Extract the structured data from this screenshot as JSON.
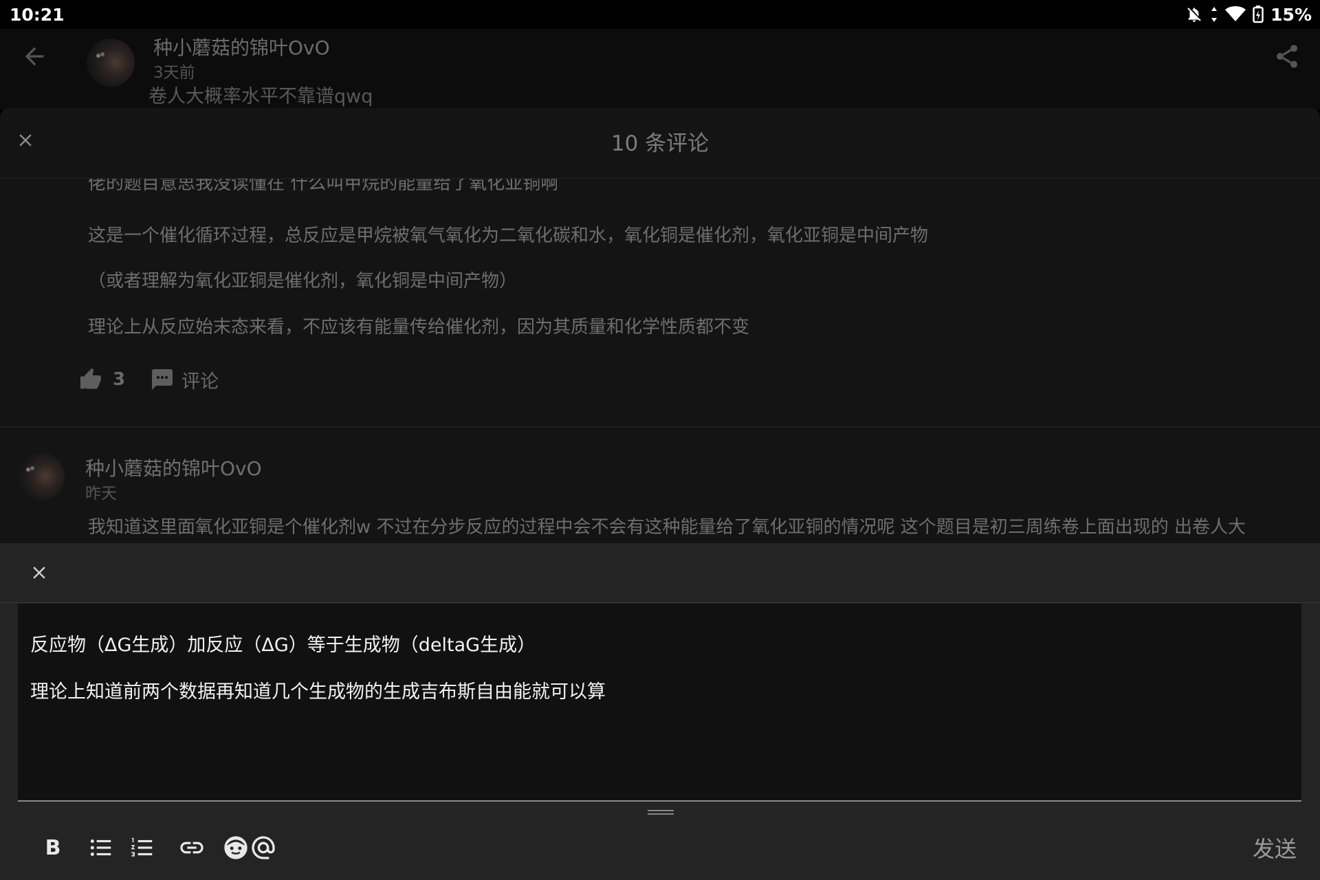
{
  "status_bar": {
    "time": "10:21",
    "battery": "15%"
  },
  "post": {
    "author": "种小蘑菇的锦叶OvO",
    "time": "3天前",
    "title": "卷人大概率水平不靠谱qwq"
  },
  "sheet": {
    "title": "10 条评论"
  },
  "comments": [
    {
      "cut_line": "佬的题目意思我没读懂在 什么叫甲烷的能量给了氧化亚铜啊",
      "lines": [
        "这是一个催化循环过程，总反应是甲烷被氧气氧化为二氧化碳和水，氧化铜是催化剂，氧化亚铜是中间产物",
        "（或者理解为氧化亚铜是催化剂，氧化铜是中间产物）",
        "理论上从反应始末态来看，不应该有能量传给催化剂，因为其质量和化学性质都不变"
      ],
      "likes": "3",
      "comment_label": "评论"
    },
    {
      "author": "种小蘑菇的锦叶OvO",
      "time": "昨天",
      "body": "我知道这里面氧化亚铜是个催化剂w 不过在分步反应的过程中会不会有这种能量给了氧化亚铜的情况呢 这个题目是初三周练卷上面出现的 出卷人大"
    }
  ],
  "editor": {
    "lines": [
      "反应物（ΔG生成）加反应（ΔG）等于生成物（deltaG生成）",
      "理论上知道前两个数据再知道几个生成物的生成吉布斯自由能就可以算"
    ]
  },
  "toolbar": {
    "bold_label": "B",
    "send_label": "发送"
  }
}
